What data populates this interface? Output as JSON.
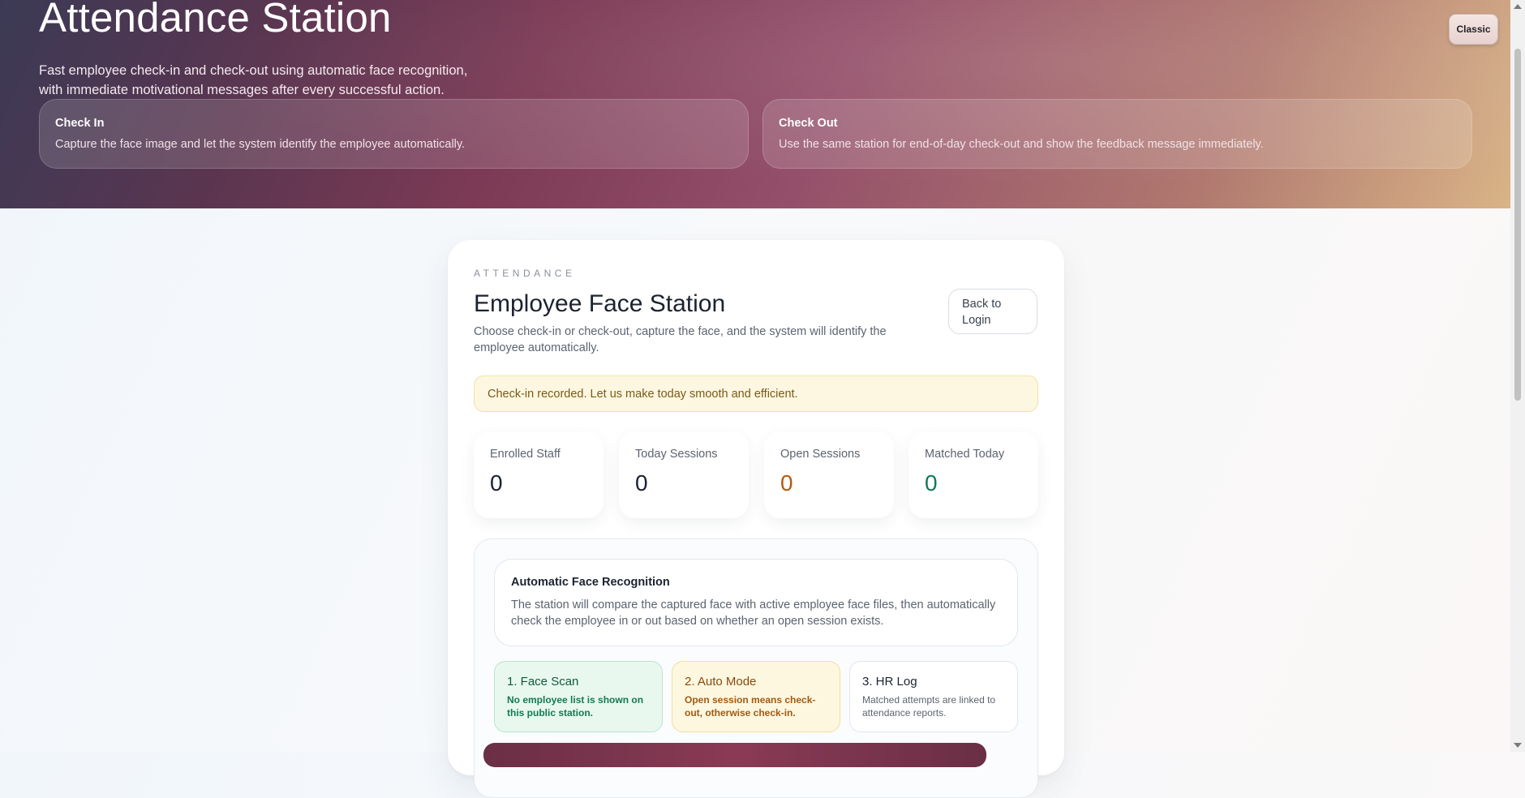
{
  "hero": {
    "title": "Attendance Station",
    "subtitle": "Fast employee check-in and check-out using automatic face recognition, with immediate motivational messages after every successful action.",
    "classic_button": "Classic",
    "cards": [
      {
        "title": "Check In",
        "desc": "Capture the face image and let the system identify the employee automatically."
      },
      {
        "title": "Check Out",
        "desc": "Use the same station for end-of-day check-out and show the feedback message immediately."
      }
    ]
  },
  "station": {
    "eyebrow": "ATTENDANCE",
    "title": "Employee Face Station",
    "description": "Choose check-in or check-out, capture the face, and the system will identify the employee automatically.",
    "back_button": "Back to Login",
    "alert": "Check-in recorded. Let us make today smooth and efficient.",
    "stats": [
      {
        "label": "Enrolled Staff",
        "value": "0"
      },
      {
        "label": "Today Sessions",
        "value": "0"
      },
      {
        "label": "Open Sessions",
        "value": "0"
      },
      {
        "label": "Matched Today",
        "value": "0"
      }
    ],
    "recognition": {
      "title": "Automatic Face Recognition",
      "desc": "The station will compare the captured face with active employee face files, then automatically check the employee in or out based on whether an open session exists."
    },
    "steps": [
      {
        "title": "1. Face Scan",
        "desc": "No employee list is shown on this public station."
      },
      {
        "title": "2. Auto Mode",
        "desc": "Open session means check-out, otherwise check-in."
      },
      {
        "title": "3. HR Log",
        "desc": "Matched attempts are linked to attendance reports."
      }
    ]
  },
  "colors": {
    "hero_gradient_start": "#3b3a55",
    "hero_gradient_mid": "#7c3a55",
    "hero_gradient_end": "#d9b487",
    "accent_orange": "#b45a0e",
    "accent_green": "#0e7a58",
    "alert_bg": "#fdf7e1"
  }
}
